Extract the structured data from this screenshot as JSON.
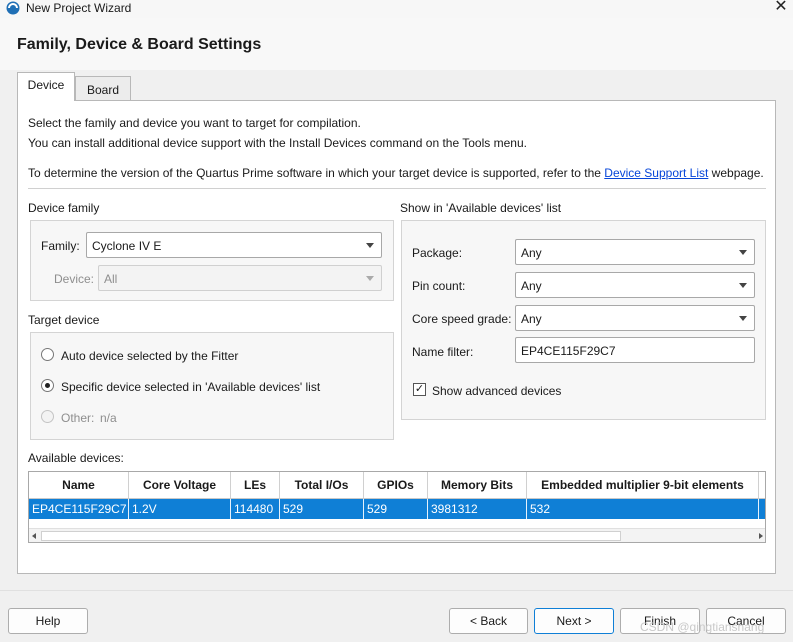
{
  "window": {
    "title": "New Project Wizard",
    "close": "✕"
  },
  "page_title": "Family, Device & Board Settings",
  "tabs": [
    {
      "label": "Device",
      "active": true
    },
    {
      "label": "Board",
      "active": false
    }
  ],
  "intro": {
    "line1": "Select the family and device you want to target for compilation.",
    "line2": "You can install additional device support with the Install Devices command on the Tools menu.",
    "line3_prefix": "To determine the version of the Quartus Prime software in which your target device is supported, refer to the ",
    "line3_link": "Device Support List",
    "line3_suffix": " webpage."
  },
  "device_family": {
    "section_label": "Device family",
    "family_label": "Family:",
    "family_value": "Cyclone IV E",
    "device_label": "Device:",
    "device_value": "All"
  },
  "target_device": {
    "section_label": "Target device",
    "options": [
      {
        "label": "Auto device selected by the Fitter",
        "checked": false,
        "enabled": true
      },
      {
        "label": "Specific device selected in 'Available devices' list",
        "checked": true,
        "enabled": true
      },
      {
        "label": "Other:",
        "checked": false,
        "enabled": false,
        "extra": "n/a"
      }
    ]
  },
  "show_in_list": {
    "section_label": "Show in 'Available devices' list",
    "package_label": "Package:",
    "package_value": "Any",
    "pin_count_label": "Pin count:",
    "pin_count_value": "Any",
    "speed_grade_label": "Core speed grade:",
    "speed_grade_value": "Any",
    "name_filter_label": "Name filter:",
    "name_filter_value": "EP4CE115F29C7",
    "show_advanced_label": "Show advanced devices",
    "show_advanced_checked": true
  },
  "available_devices": {
    "label": "Available devices:",
    "columns": [
      "Name",
      "Core Voltage",
      "LEs",
      "Total I/Os",
      "GPIOs",
      "Memory Bits",
      "Embedded multiplier 9-bit elements"
    ],
    "rows": [
      [
        "EP4CE115F29C7",
        "1.2V",
        "114480",
        "529",
        "529",
        "3981312",
        "532"
      ]
    ]
  },
  "buttons": {
    "help": "Help",
    "back": "< Back",
    "next": "Next >",
    "finish": "Finish",
    "cancel": "Cancel"
  },
  "watermark": "CSDN @qingtianshang",
  "colors": {
    "selection": "#0f7fd6",
    "link": "#0645d9"
  }
}
